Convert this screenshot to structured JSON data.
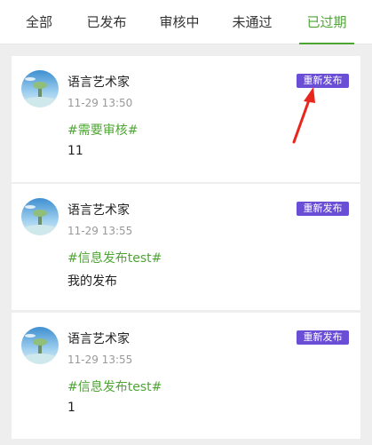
{
  "tabs": [
    {
      "label": "全部",
      "active": false
    },
    {
      "label": "已发布",
      "active": false
    },
    {
      "label": "审核中",
      "active": false
    },
    {
      "label": "未通过",
      "active": false
    },
    {
      "label": "已过期",
      "active": true
    }
  ],
  "posts": [
    {
      "author": "语言艺术家",
      "time": "11-29 13:50",
      "tag": "#需要审核#",
      "content": "11",
      "republish_label": "重新发布"
    },
    {
      "author": "语言艺术家",
      "time": "11-29 13:55",
      "tag": "#信息发布test#",
      "content": "我的发布",
      "republish_label": "重新发布"
    },
    {
      "author": "语言艺术家",
      "time": "11-29 13:55",
      "tag": "#信息发布test#",
      "content": "1",
      "republish_label": "重新发布"
    }
  ],
  "colors": {
    "accent_green": "#4ea534",
    "republish_purple": "#6a4fd6",
    "annotation_red": "#e8261e"
  }
}
